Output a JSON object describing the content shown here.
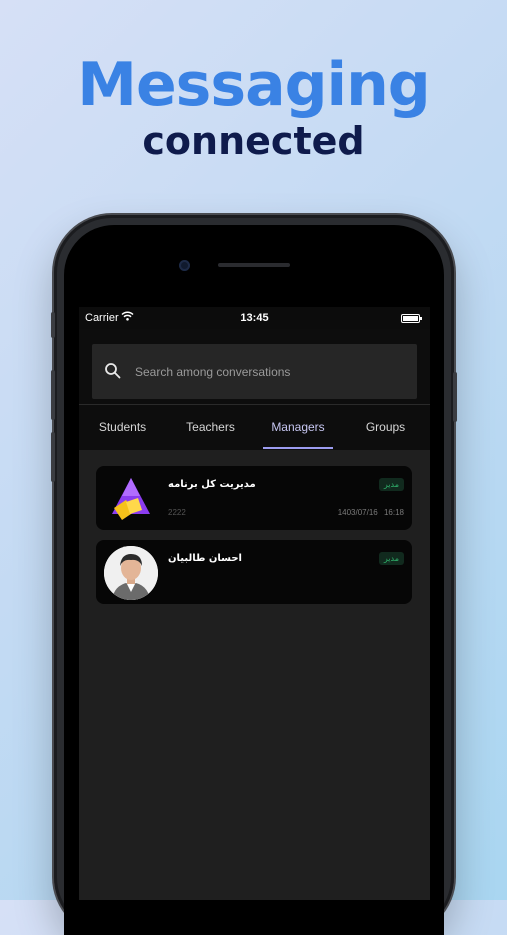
{
  "hero": {
    "title": "Messaging",
    "subtitle": "connected"
  },
  "status_bar": {
    "carrier": "Carrier",
    "time": "13:45"
  },
  "search": {
    "placeholder": "Search among conversations"
  },
  "tabs": [
    {
      "label": "Students",
      "active": false
    },
    {
      "label": "Teachers",
      "active": false
    },
    {
      "label": "Managers",
      "active": true
    },
    {
      "label": "Groups",
      "active": false
    }
  ],
  "conversations": [
    {
      "name": "مدیریت کل برنامه",
      "role": "مدیر",
      "preview": "2222",
      "date": "1403/07/16",
      "time": "16:18",
      "avatar": "logo"
    },
    {
      "name": "احسان طالبیان",
      "role": "مدیر",
      "preview": "",
      "date": "",
      "time": "",
      "avatar": "person"
    }
  ],
  "colors": {
    "accent": "#3a82e4",
    "tab_active": "#c7c7f2",
    "role_badge": "#2fae6a"
  }
}
